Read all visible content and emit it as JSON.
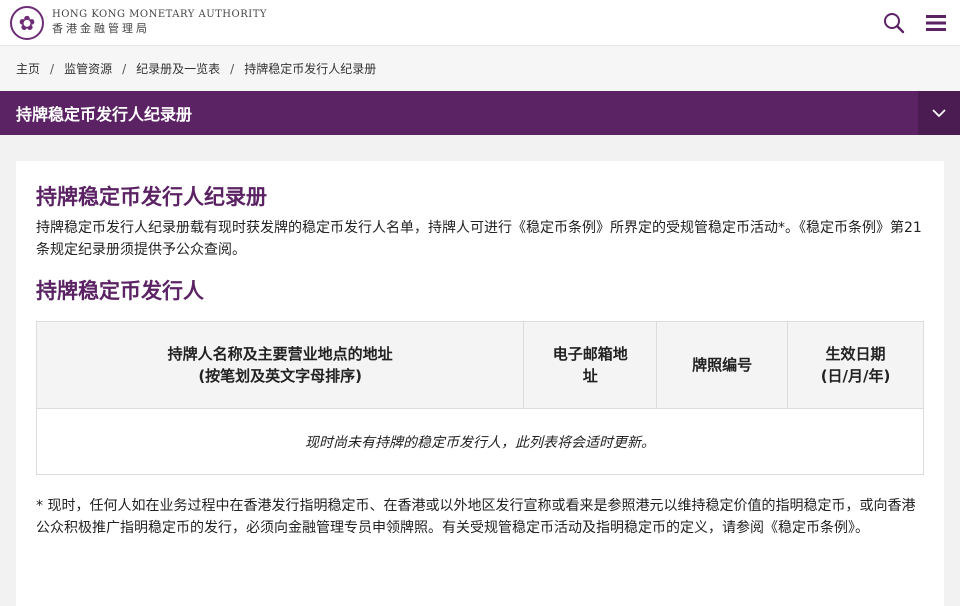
{
  "header": {
    "org_en": "HONG KONG MONETARY AUTHORITY",
    "org_zh": "香港金融管理局",
    "icons": [
      "search-icon",
      "menu-icon"
    ],
    "logo_glyph": "✿"
  },
  "breadcrumb": {
    "items": [
      "主页",
      "监管资源",
      "纪录册及一览表",
      "持牌稳定币发行人纪录册"
    ],
    "separator": "/"
  },
  "section_bar": {
    "title": "持牌稳定币发行人纪录册",
    "toggle_icon": "chevron-down-icon"
  },
  "content": {
    "title": "持牌稳定币发行人纪录册",
    "intro": "持牌稳定币发行人纪录册载有现时获发牌的稳定币发行人名单，持牌人可进行《稳定币条例》所界定的受规管稳定币活动*。《稳定币条例》第21条规定纪录册须提供予公众查阅。",
    "subtitle": "持牌稳定币发行人",
    "table": {
      "columns": [
        {
          "line1": "持牌人名称及主要营业地点的地址",
          "line2": "(按笔划及英文字母排序)"
        },
        {
          "line1": "电子邮箱地",
          "line2": "址"
        },
        {
          "line1": "牌照编号",
          "line2": ""
        },
        {
          "line1": "生效日期",
          "line2": "(日/月/年)"
        }
      ],
      "empty_message": "现时尚未有持牌的稳定币发行人，此列表将会适时更新。"
    },
    "footnote": "* 现时，任何人如在业务过程中在香港发行指明稳定币、在香港或以外地区发行宣称或看来是参照港元以维持稳定价值的指明稳定币，或向香港公众积极推广指明稳定币的发行，必须向金融管理专员申领牌照。有关受规管稳定币活动及指明稳定币的定义，请参阅《稳定币条例》。"
  },
  "colors": {
    "brand_purple": "#5b2364",
    "toggle_purple": "#4a1c52",
    "title_purple": "#5b2364"
  }
}
